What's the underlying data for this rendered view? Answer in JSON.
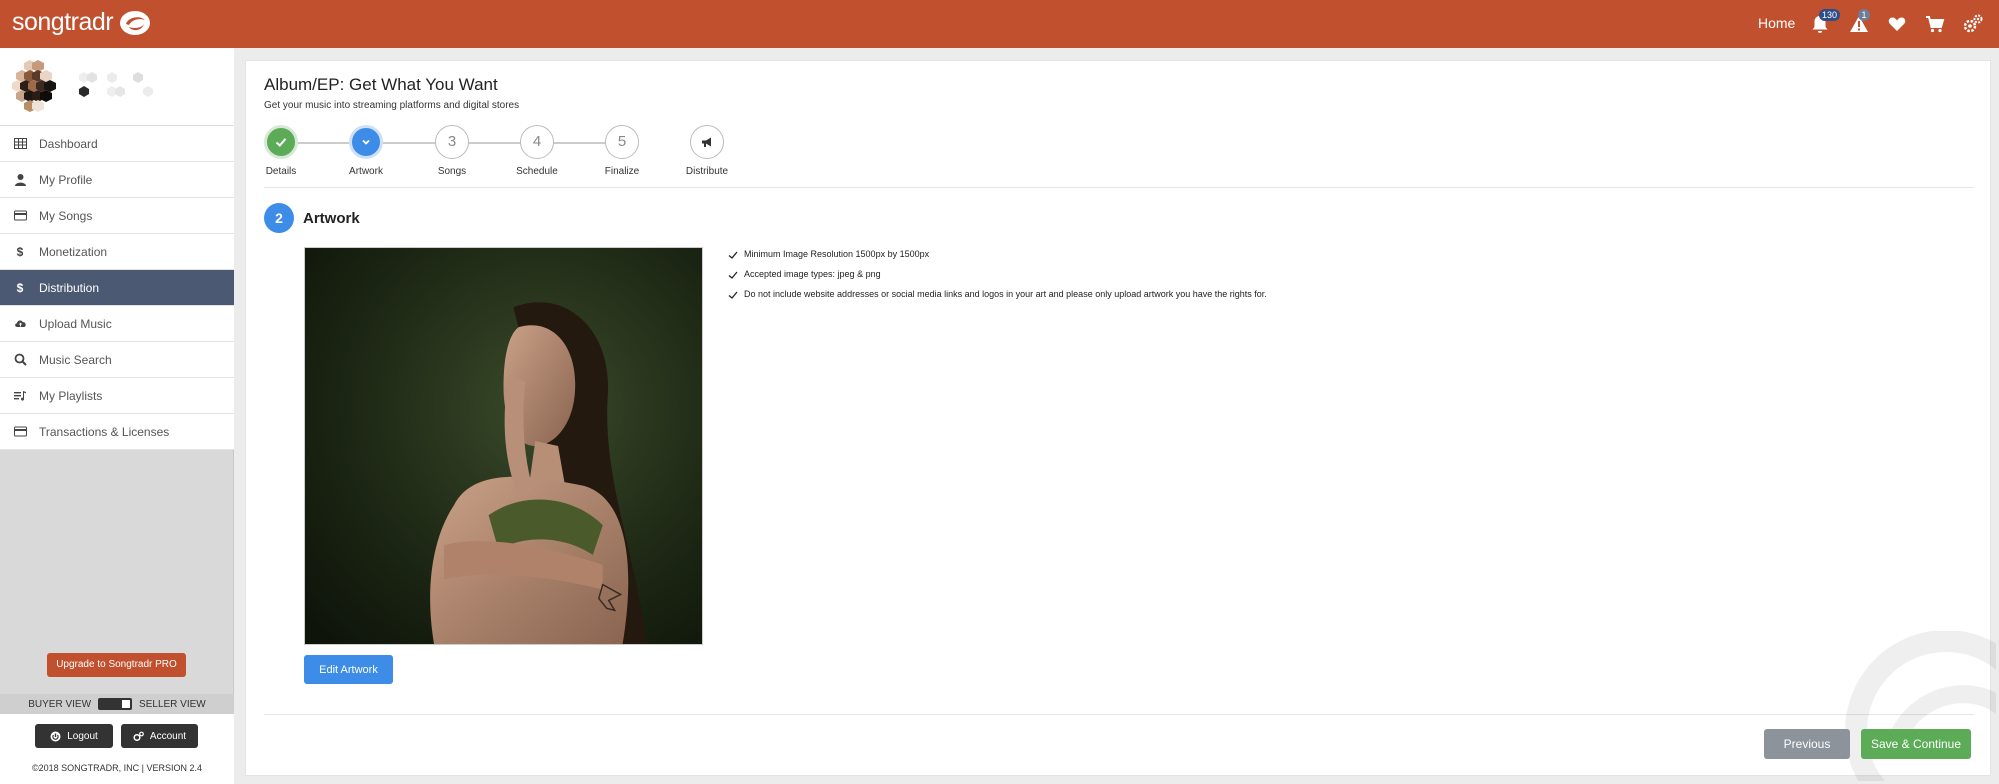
{
  "header": {
    "logo_text": "songtradr",
    "home_label": "Home",
    "notifications_count": "130",
    "alerts_count": "1",
    "brand_color": "#c1502e"
  },
  "sidebar": {
    "items": [
      {
        "label": "Dashboard",
        "icon": "table-icon"
      },
      {
        "label": "My Profile",
        "icon": "user-icon"
      },
      {
        "label": "My Songs",
        "icon": "card-icon"
      },
      {
        "label": "Monetization",
        "icon": "dollar-icon"
      },
      {
        "label": "Distribution",
        "icon": "dollar-icon",
        "active": true
      },
      {
        "label": "Upload Music",
        "icon": "cloud-upload-icon"
      },
      {
        "label": "Music Search",
        "icon": "search-icon"
      },
      {
        "label": "My Playlists",
        "icon": "playlist-icon"
      },
      {
        "label": "Transactions & Licenses",
        "icon": "card-icon"
      }
    ],
    "upgrade_label": "Upgrade to Songtradr PRO",
    "buyer_view_label": "BUYER VIEW",
    "seller_view_label": "SELLER VIEW",
    "logout_label": "Logout",
    "account_label": "Account",
    "copyright": "©2018 SONGTRADR, INC | VERSION 2.4",
    "active_color": "#4b5a72"
  },
  "main": {
    "title": "Album/EP: Get What You Want",
    "subtitle": "Get your music into streaming platforms and digital stores",
    "steps": [
      {
        "label": "Details",
        "state": "done"
      },
      {
        "label": "Artwork",
        "state": "current"
      },
      {
        "number": "3",
        "label": "Songs",
        "state": "pending"
      },
      {
        "number": "4",
        "label": "Schedule",
        "state": "pending"
      },
      {
        "number": "5",
        "label": "Finalize",
        "state": "pending"
      },
      {
        "label": "Distribute",
        "state": "pending",
        "icon": "megaphone-icon"
      }
    ],
    "section_number": "2",
    "section_title": "Artwork",
    "edit_artwork_label": "Edit Artwork",
    "requirements": [
      "Minimum Image Resolution 1500px by 1500px",
      "Accepted image types: jpeg & png",
      "Do not include website addresses or social media links and logos in your art and please only upload artwork you have the rights for."
    ],
    "previous_label": "Previous",
    "save_continue_label": "Save & Continue",
    "accent_blue": "#3d8ce8",
    "accent_green": "#5bab57"
  }
}
